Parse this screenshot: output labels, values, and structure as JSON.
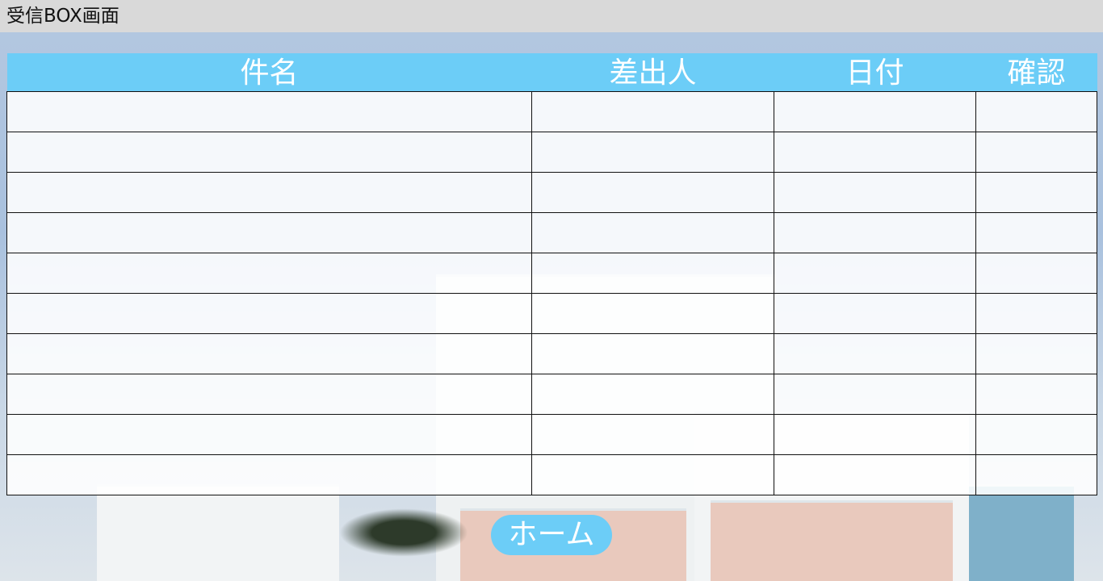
{
  "window": {
    "title": "受信BOX画面"
  },
  "table": {
    "headers": [
      "件名",
      "差出人",
      "日付",
      "確認"
    ],
    "rows": [
      [
        "",
        "",
        "",
        ""
      ],
      [
        "",
        "",
        "",
        ""
      ],
      [
        "",
        "",
        "",
        ""
      ],
      [
        "",
        "",
        "",
        ""
      ],
      [
        "",
        "",
        "",
        ""
      ],
      [
        "",
        "",
        "",
        ""
      ],
      [
        "",
        "",
        "",
        ""
      ],
      [
        "",
        "",
        "",
        ""
      ],
      [
        "",
        "",
        "",
        ""
      ],
      [
        "",
        "",
        "",
        ""
      ]
    ]
  },
  "actions": {
    "home_label": "ホーム"
  },
  "colors": {
    "header_bg": "#6ccdf7",
    "titlebar_bg": "#d9d9d9",
    "button_bg": "#6ccdf7"
  }
}
